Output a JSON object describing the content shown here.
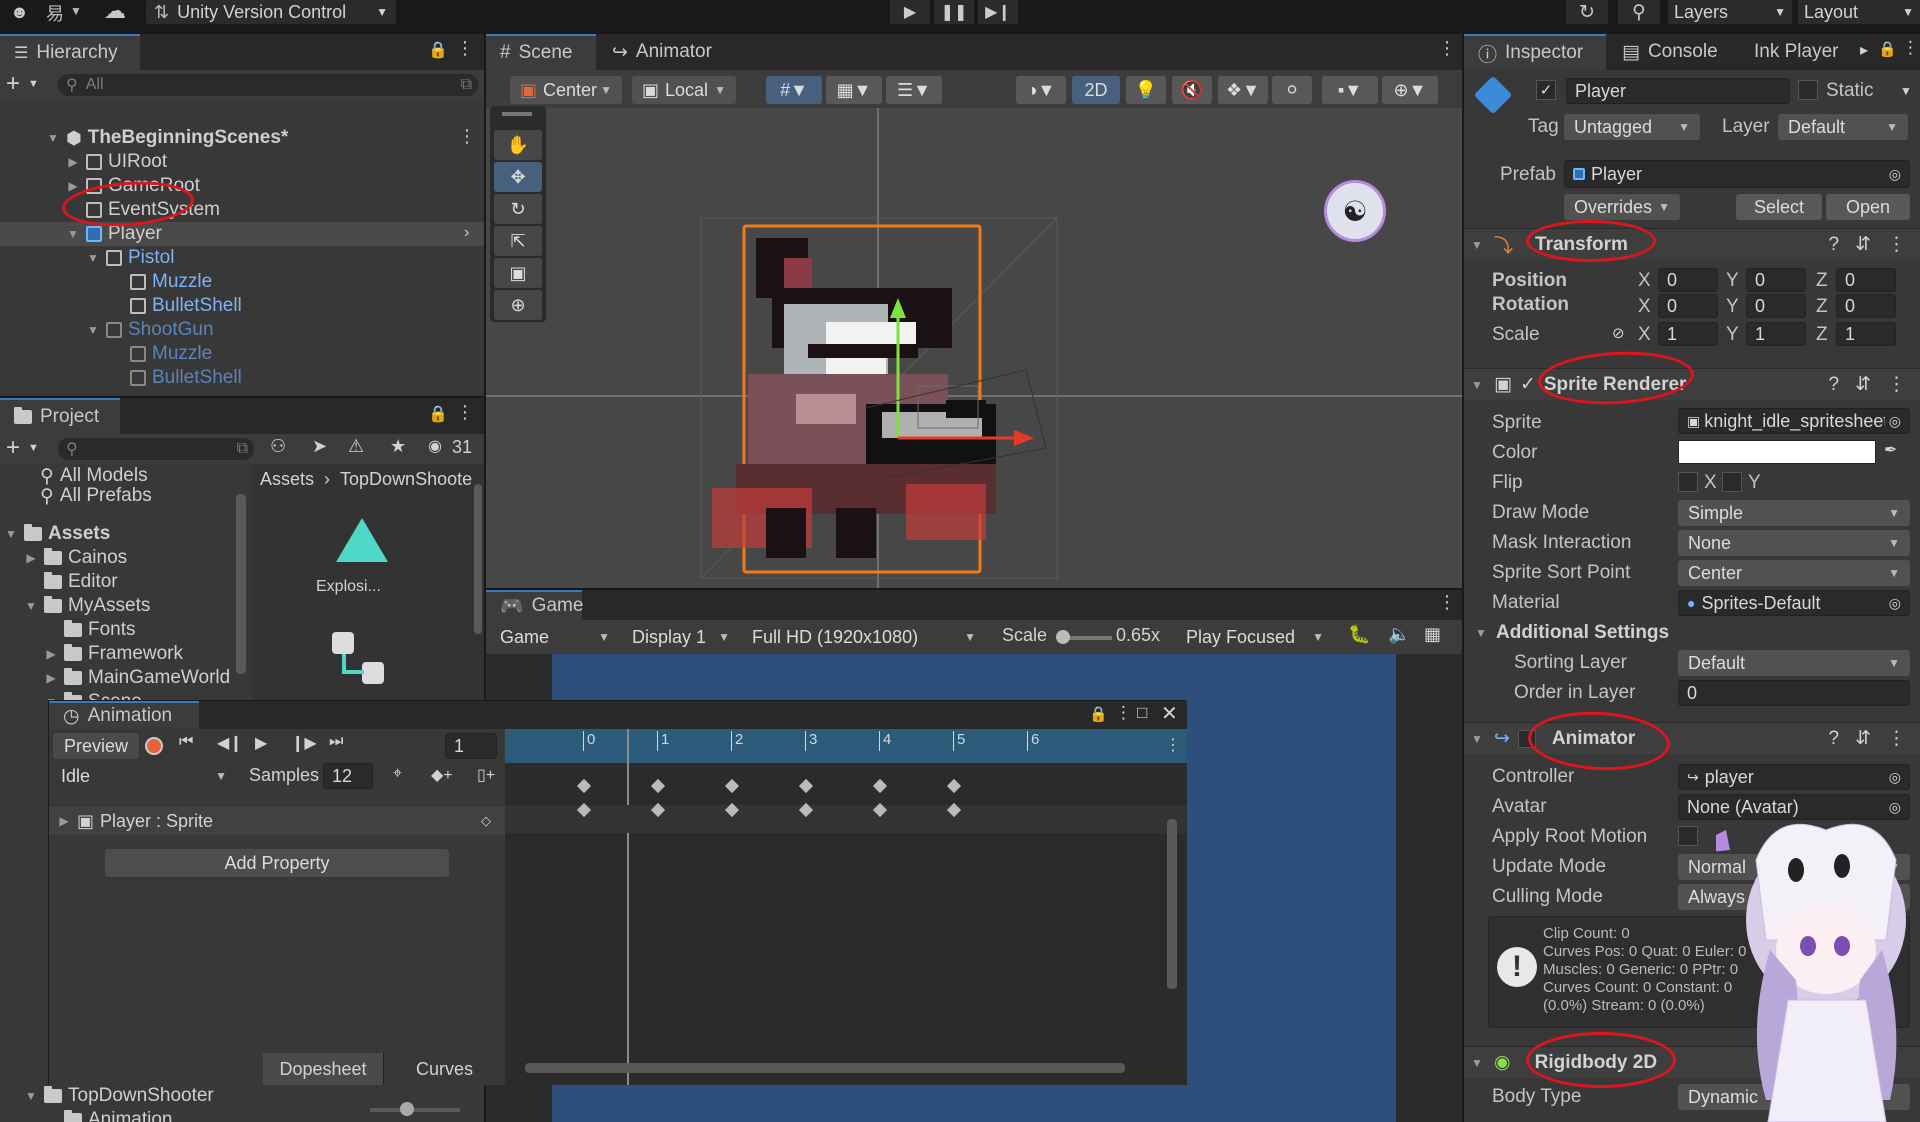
{
  "top": {
    "version_control": "Unity Version Control",
    "account_initial": "易",
    "layers_label": "Layers",
    "layout_label": "Layout"
  },
  "hierarchy": {
    "title": "Hierarchy",
    "search_placeholder": "All",
    "scene_name": "TheBeginningScenes*",
    "items": [
      "UIRoot",
      "GameRoot",
      "EventSystem",
      "Player",
      "Pistol",
      "Muzzle",
      "BulletShell",
      "ShootGun",
      "Muzzle",
      "BulletShell"
    ]
  },
  "scene": {
    "tab_scene": "Scene",
    "tab_animator": "Animator",
    "pivot": "Center",
    "space": "Local",
    "mode_2d": "2D"
  },
  "game": {
    "tab": "Game",
    "mode": "Game",
    "display": "Display 1",
    "resolution": "Full HD (1920x1080)",
    "scale_label": "Scale",
    "scale_value": "0.65x",
    "play_mode": "Play Focused"
  },
  "project": {
    "title": "Project",
    "count": "31",
    "favorites": [
      "All Models",
      "All Prefabs"
    ],
    "tree": [
      "Assets",
      "Cainos",
      "Editor",
      "MyAssets",
      "Fonts",
      "Framework",
      "MainGameWorld",
      "Scene",
      "TopDownShooter",
      "Animation"
    ],
    "breadcrumb": [
      "Assets",
      "TopDownShoote"
    ],
    "asset_label": "Explosi..."
  },
  "animation": {
    "title": "Animation",
    "preview": "Preview",
    "frame": "1",
    "clip": "Idle",
    "samples_label": "Samples",
    "samples": "12",
    "property": "Player : Sprite",
    "add_property": "Add Property",
    "dopesheet": "Dopesheet",
    "curves": "Curves",
    "timeline_ticks": [
      "0",
      "1",
      "2",
      "3",
      "4",
      "5",
      "6"
    ],
    "keyframe_indices": [
      0,
      1,
      2,
      3,
      4,
      5
    ]
  },
  "inspector": {
    "tab_inspector": "Inspector",
    "tab_console": "Console",
    "tab_ink": "Ink Player",
    "object_name": "Player",
    "static_label": "Static",
    "tag_label": "Tag",
    "tag_value": "Untagged",
    "layer_label": "Layer",
    "layer_value": "Default",
    "prefab_label": "Prefab",
    "prefab_value": "Player",
    "overrides": "Overrides",
    "select": "Select",
    "open": "Open",
    "transform": {
      "title": "Transform",
      "position_label": "Position",
      "rotation_label": "Rotation",
      "scale_label": "Scale",
      "position": [
        "0",
        "0",
        "0"
      ],
      "rotation": [
        "0",
        "0",
        "0"
      ],
      "scale": [
        "1",
        "1",
        "1"
      ]
    },
    "sprite_renderer": {
      "title": "Sprite Renderer",
      "sprite_label": "Sprite",
      "sprite_value": "knight_idle_spritesheet",
      "color_label": "Color",
      "color_value": "#ffffff",
      "flip_label": "Flip",
      "flip_x": "X",
      "flip_y": "Y",
      "draw_mode_label": "Draw Mode",
      "draw_mode": "Simple",
      "mask_label": "Mask Interaction",
      "mask": "None",
      "sort_point_label": "Sprite Sort Point",
      "sort_point": "Center",
      "material_label": "Material",
      "material": "Sprites-Default",
      "additional": "Additional Settings",
      "sorting_layer_label": "Sorting Layer",
      "sorting_layer": "Default",
      "order_label": "Order in Layer",
      "order": "0"
    },
    "animator": {
      "title": "Animator",
      "controller_label": "Controller",
      "controller": "player",
      "avatar_label": "Avatar",
      "avatar": "None (Avatar)",
      "root_motion_label": "Apply Root Motion",
      "update_label": "Update Mode",
      "update": "Normal",
      "culling_label": "Culling Mode",
      "culling": "Always Animate",
      "info": [
        "Clip Count: 0",
        "Curves Pos: 0 Quat: 0 Euler: 0",
        "Muscles: 0 Generic: 0 PPtr: 0",
        "Curves Count: 0 Constant: 0",
        "(0.0%) Stream: 0 (0.0%)"
      ]
    },
    "rigidbody": {
      "title": "Rigidbody 2D",
      "body_type_label": "Body Type",
      "body_type": "Dynamic"
    }
  }
}
